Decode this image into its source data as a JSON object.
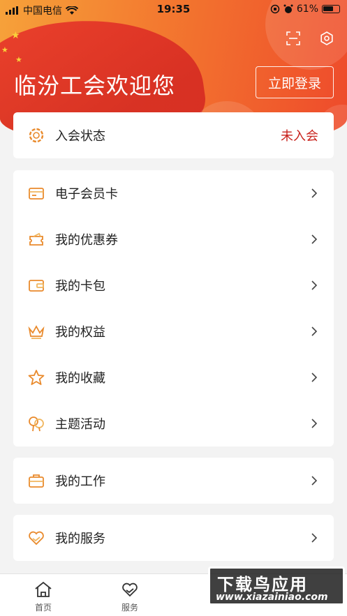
{
  "status_bar": {
    "carrier": "中国电信",
    "time": "19:35",
    "battery": "61%"
  },
  "header": {
    "welcome": "临汾工会欢迎您",
    "login_label": "立即登录",
    "icons": [
      "scan-icon",
      "settings-icon"
    ]
  },
  "membership": {
    "label": "入会状态",
    "value": "未入会"
  },
  "menu_group_1": [
    {
      "label": "电子会员卡",
      "icon": "card-icon"
    },
    {
      "label": "我的优惠券",
      "icon": "coupon-icon"
    },
    {
      "label": "我的卡包",
      "icon": "wallet-icon"
    },
    {
      "label": "我的权益",
      "icon": "crown-icon"
    },
    {
      "label": "我的收藏",
      "icon": "star-icon"
    },
    {
      "label": "主题活动",
      "icon": "balloon-icon"
    }
  ],
  "menu_group_2": [
    {
      "label": "我的工作",
      "icon": "briefcase-icon"
    }
  ],
  "menu_group_3": [
    {
      "label": "我的服务",
      "icon": "heart-hand-icon"
    }
  ],
  "bottom_nav": [
    {
      "label": "首页",
      "icon": "home-icon"
    },
    {
      "label": "服务",
      "icon": "service-heart-icon"
    }
  ],
  "watermark": {
    "title": "下载鸟应用",
    "url": "www.xiazainiao.com"
  },
  "colors": {
    "accent": "#f0592c",
    "status_red": "#c8221c",
    "icon_orange": "#e98a2c"
  }
}
